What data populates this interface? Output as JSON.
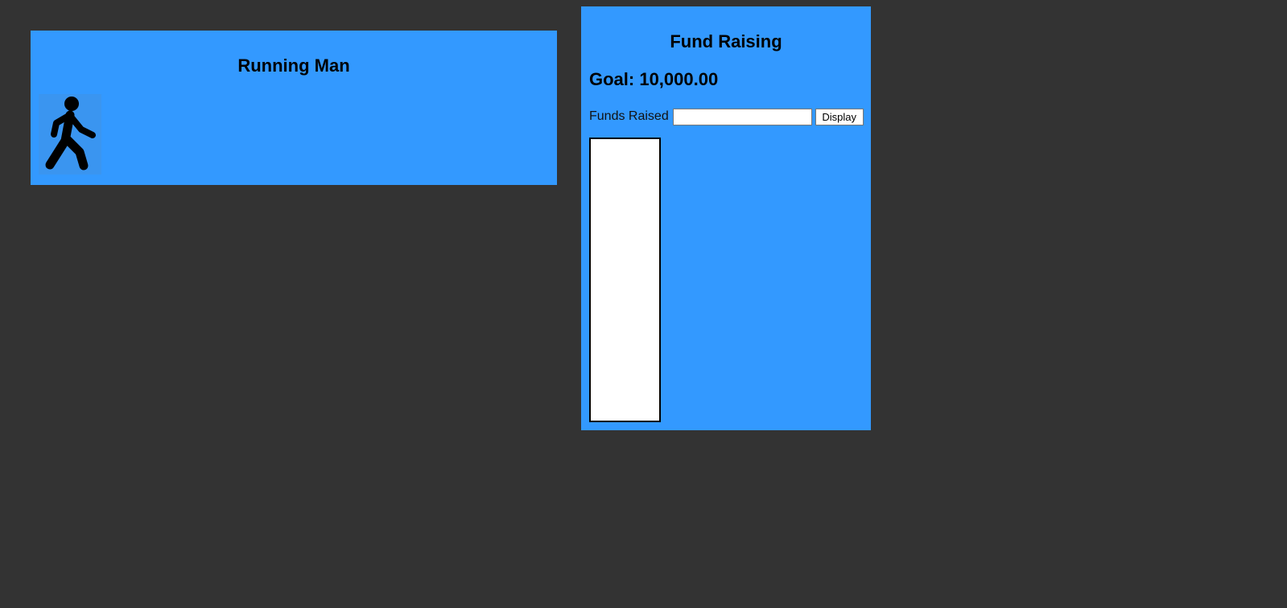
{
  "running_panel": {
    "title": "Running Man",
    "icon": "walking-person-icon"
  },
  "fund_panel": {
    "title": "Fund Raising",
    "goal_text": "Goal: 10,000.00",
    "funds_label": "Funds Raised",
    "funds_value": "",
    "display_label": "Display",
    "progress_fraction": 0
  },
  "colors": {
    "page_background": "#333333",
    "panel_background": "#3399ff",
    "meter_background": "#ffffff"
  }
}
